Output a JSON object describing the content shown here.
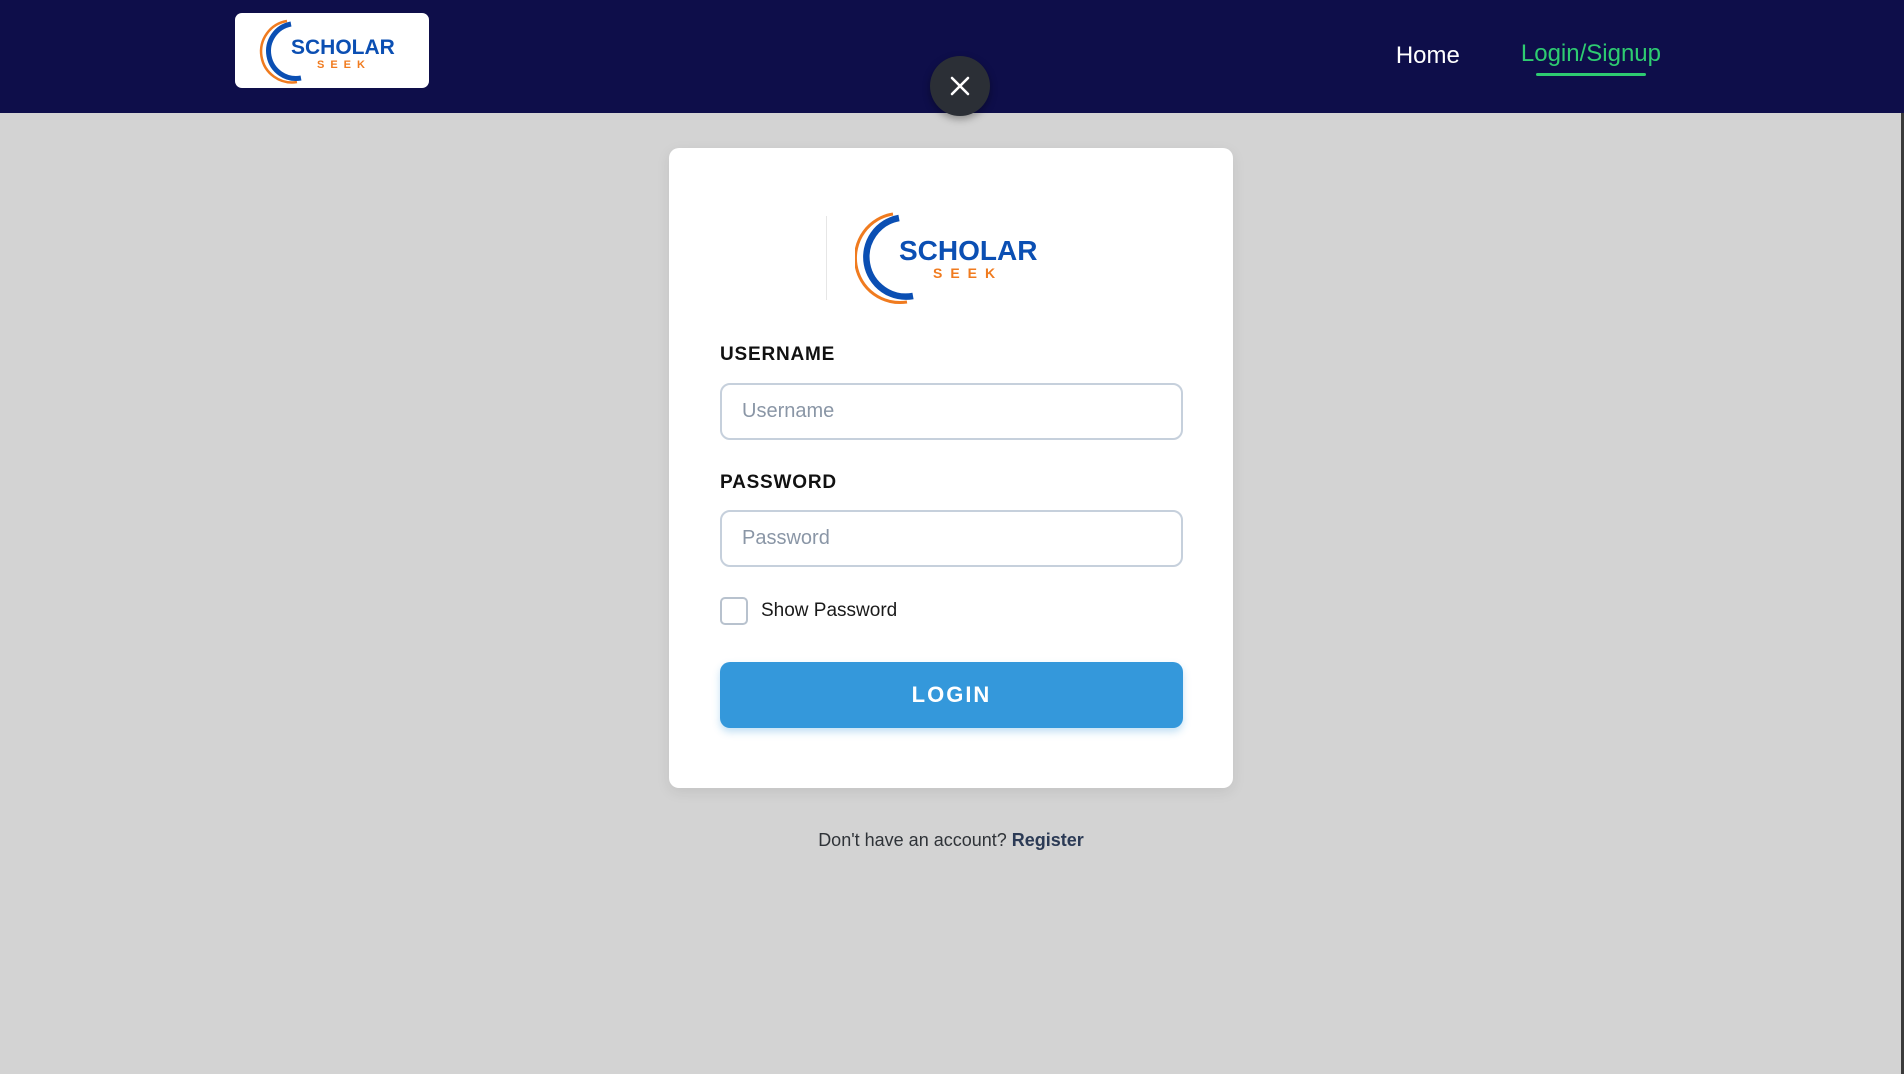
{
  "brand": {
    "logo_word_top": "SCHOLAR",
    "logo_word_bottom": "SEEK",
    "logo_blue": "#0b4fb3",
    "logo_orange": "#f07b1f"
  },
  "nav": {
    "home_label": "Home",
    "login_label": "Login/Signup",
    "background": "#0e0e4a",
    "active_color": "#2ecc71"
  },
  "modal": {
    "close_icon": "close-icon",
    "username_label": "USERNAME",
    "username_placeholder": "Username",
    "username_value": "",
    "password_label": "PASSWORD",
    "password_placeholder": "Password",
    "password_value": "",
    "show_password_label": "Show Password",
    "show_password_checked": false,
    "login_button_label": "LOGIN",
    "button_color": "#3498db"
  },
  "footer": {
    "register_prompt": "Don't have an account?",
    "register_link": "Register"
  }
}
